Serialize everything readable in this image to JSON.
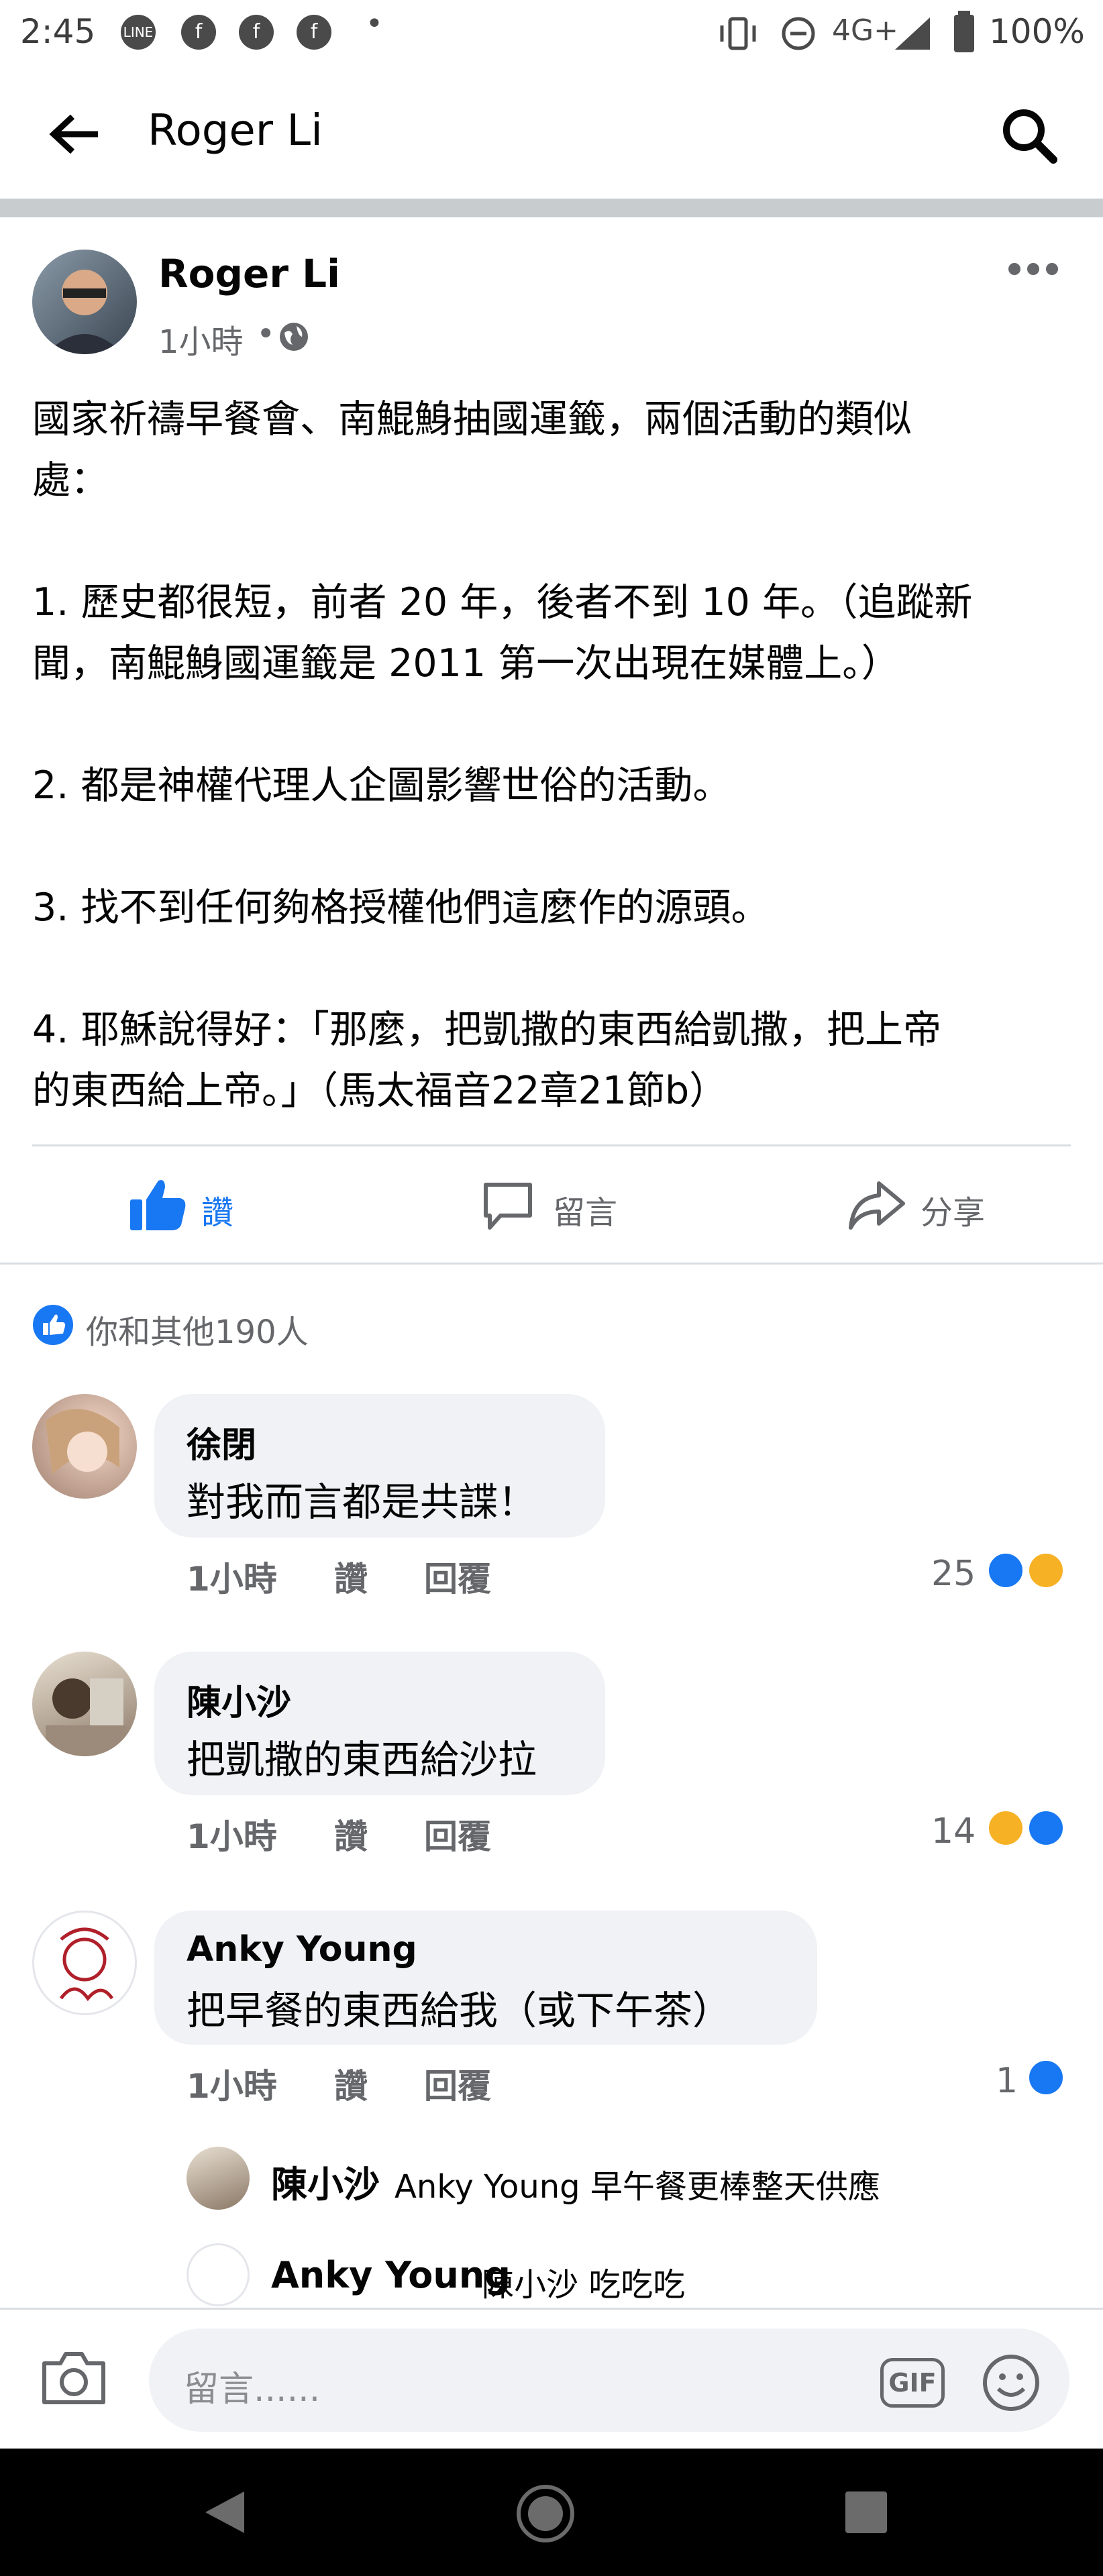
{
  "status_bar": {
    "time": "2:45",
    "dot": "•",
    "network": "4G+",
    "battery": "100%"
  },
  "header": {
    "title": "Roger Li"
  },
  "post": {
    "author": "Roger Li",
    "time": "1小時",
    "sep": "•",
    "body": "國家祈禱早餐會、南鯤鯓抽國運籤，兩個活動的類似\n處：\n\n1. 歷史都很短，前者 20 年，後者不到 10 年。（追蹤新\n聞，南鯤鯓國運籤是 2011 第一次出現在媒體上。）\n\n2. 都是神權代理人企圖影響世俗的活動。\n\n3. 找不到任何夠格授權他們這麼作的源頭。\n\n4. 耶穌說得好：「那麼，把凱撒的東西給凱撒，把上帝\n的東西給上帝。」（馬太福音22章21節b）",
    "actions": {
      "like": "讚",
      "comment": "留言",
      "share": "分享"
    },
    "reactions_summary": "你和其他190人"
  },
  "comments": [
    {
      "name": "徐閉",
      "text": "對我而言都是共諜！",
      "time": "1小時",
      "like": "讚",
      "reply": "回覆",
      "count": "25"
    },
    {
      "name": "陳小沙",
      "text": "把凱撒的東西給沙拉",
      "time": "1小時",
      "like": "讚",
      "reply": "回覆",
      "count": "14"
    },
    {
      "name": "Anky Young",
      "text": "把早餐的東西給我（或下午茶）",
      "time": "1小時",
      "like": "讚",
      "reply": "回覆",
      "count": "1"
    }
  ],
  "replies": [
    {
      "name": "陳小沙",
      "text": "Anky Young 早午餐更棒整天供應"
    },
    {
      "name": "Anky Young",
      "text": "陳小沙 吃吃吃"
    }
  ],
  "composer": {
    "placeholder": "留言......",
    "gif": "GIF"
  },
  "colors": {
    "accent": "#1877f2",
    "haha": "#f7b125",
    "bubble": "#f0f2f5"
  }
}
